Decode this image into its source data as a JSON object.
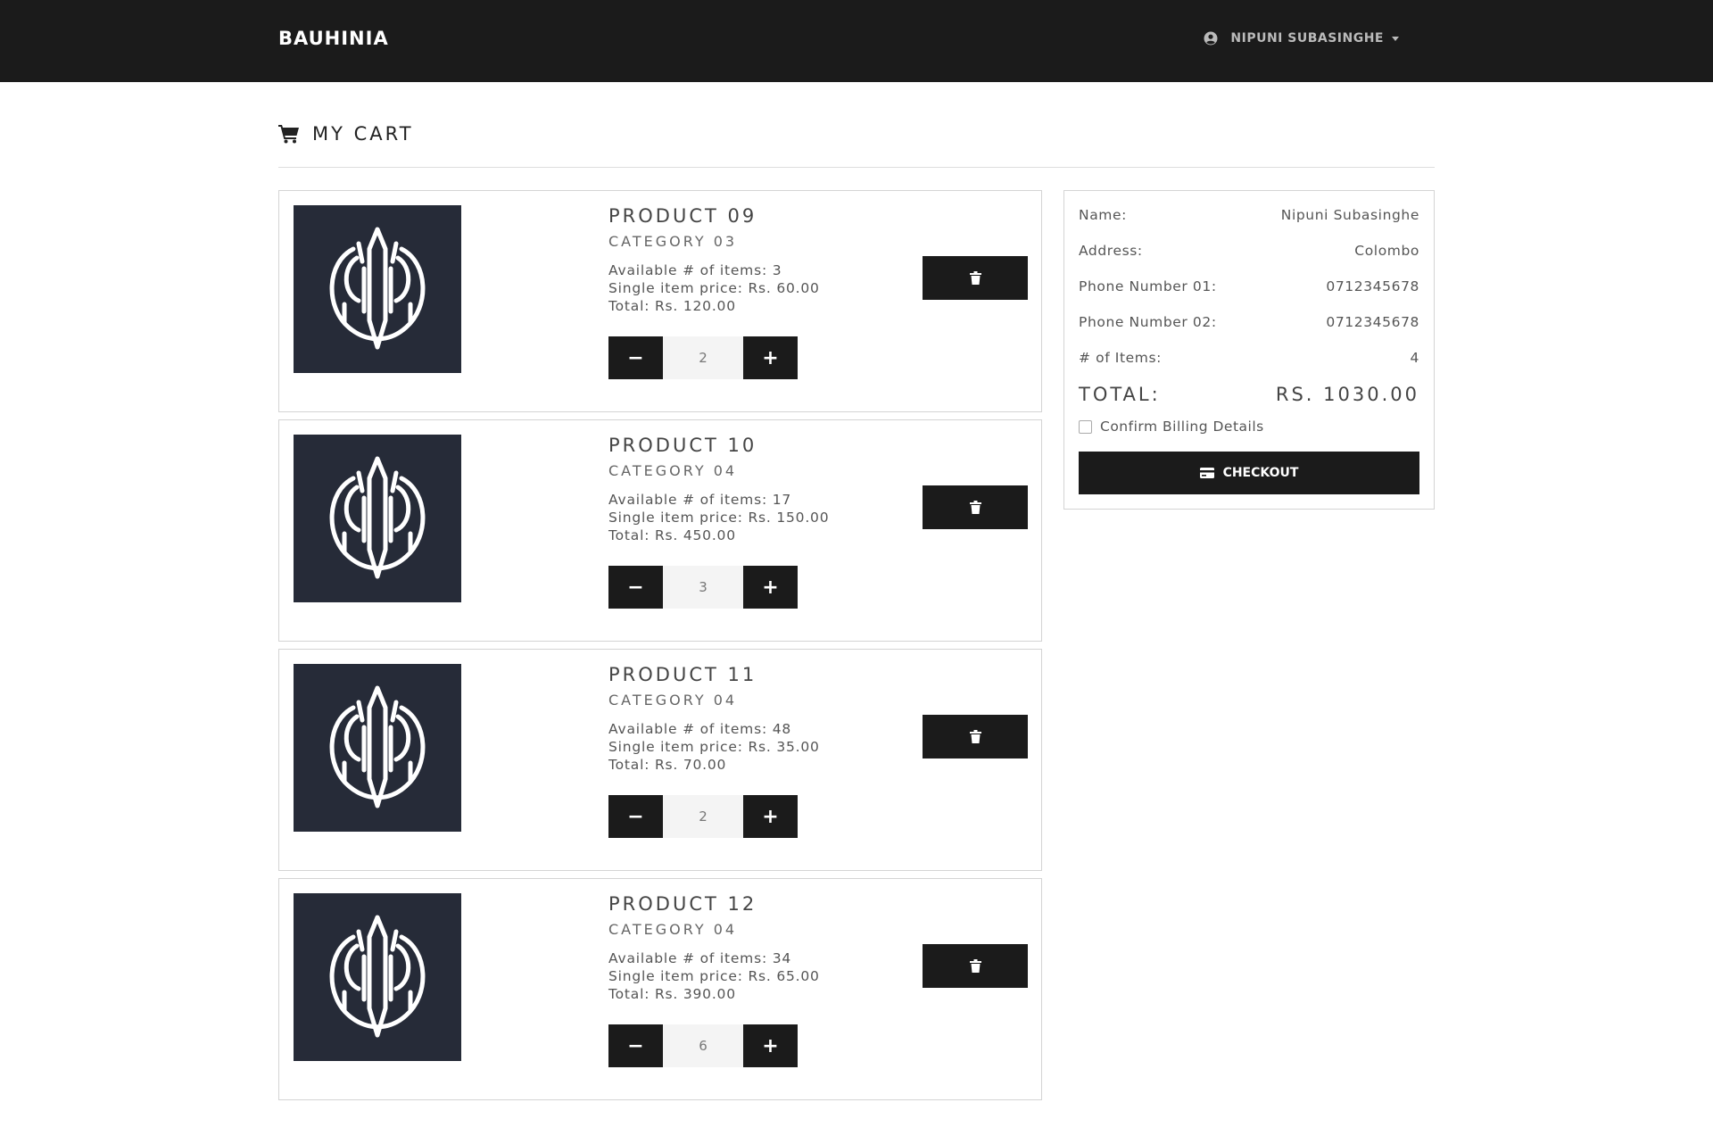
{
  "navbar": {
    "brand": "BAUHINIA",
    "user_name": "NIPUNI SUBASINGHE",
    "user_icon": "user-circle-icon"
  },
  "page": {
    "title": "MY CART",
    "icon": "cart-icon"
  },
  "cart_items": [
    {
      "name": "PRODUCT 09",
      "category": "CATEGORY 03",
      "available": "Available # of items: 3",
      "price": "Single item price: Rs. 60.00",
      "total": "Total: Rs. 120.00",
      "quantity": "2"
    },
    {
      "name": "PRODUCT 10",
      "category": "CATEGORY 04",
      "available": "Available # of items: 17",
      "price": "Single item price: Rs. 150.00",
      "total": "Total: Rs. 450.00",
      "quantity": "3"
    },
    {
      "name": "PRODUCT 11",
      "category": "CATEGORY 04",
      "available": "Available # of items: 48",
      "price": "Single item price: Rs. 35.00",
      "total": "Total: Rs. 70.00",
      "quantity": "2"
    },
    {
      "name": "PRODUCT 12",
      "category": "CATEGORY 04",
      "available": "Available # of items: 34",
      "price": "Single item price: Rs. 65.00",
      "total": "Total: Rs. 390.00",
      "quantity": "6"
    }
  ],
  "quantity_controls": {
    "minus": "−",
    "plus": "+"
  },
  "summary": {
    "name_label": "Name:",
    "name_value": "Nipuni Subasinghe",
    "address_label": "Address:",
    "address_value": "Colombo",
    "phone1_label": "Phone Number 01:",
    "phone1_value": "0712345678",
    "phone2_label": "Phone Number 02:",
    "phone2_value": "0712345678",
    "items_label": "# of Items:",
    "items_value": "4",
    "total_label": "TOTAL:",
    "total_value": "RS. 1030.00",
    "confirm_label": "Confirm Billing Details",
    "confirm_checked": false,
    "checkout_label": "CHECKOUT"
  },
  "colors": {
    "navbar_bg": "#1b1b1b",
    "button_bg": "#1b1b1b",
    "image_bg": "#262b38"
  }
}
